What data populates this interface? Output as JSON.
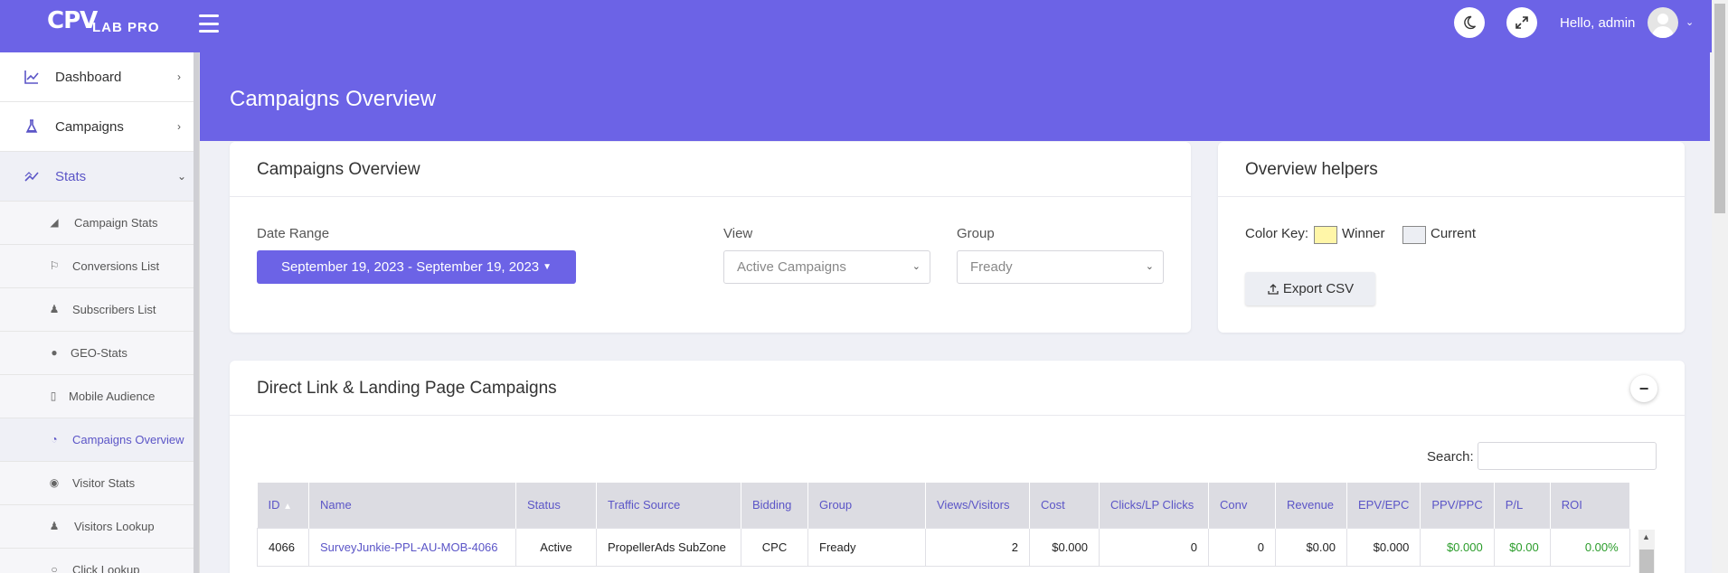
{
  "brand": {
    "mark": "CPV",
    "sub": "LAB PRO"
  },
  "topbar": {
    "greeting": "Hello, admin"
  },
  "sidebar": {
    "items": [
      {
        "label": "Dashboard"
      },
      {
        "label": "Campaigns"
      },
      {
        "label": "Stats"
      }
    ],
    "stats_sub": [
      {
        "label": "Campaign Stats"
      },
      {
        "label": "Conversions List"
      },
      {
        "label": "Subscribers List"
      },
      {
        "label": "GEO-Stats"
      },
      {
        "label": "Mobile Audience"
      },
      {
        "label": "Campaigns Overview"
      },
      {
        "label": "Visitor Stats"
      },
      {
        "label": "Visitors Lookup"
      },
      {
        "label": "Click Lookup"
      }
    ]
  },
  "page": {
    "title": "Campaigns Overview"
  },
  "overview_card": {
    "title": "Campaigns Overview",
    "date_range_label": "Date Range",
    "date_range_value": "September 19, 2023 - September 19, 2023",
    "view_label": "View",
    "view_value": "Active Campaigns",
    "group_label": "Group",
    "group_value": "Fready"
  },
  "helpers_card": {
    "title": "Overview helpers",
    "color_key_label": "Color Key:",
    "winner_label": "Winner",
    "current_label": "Current",
    "winner_color": "#fff6a8",
    "current_color": "#eceef3",
    "export_label": "Export CSV"
  },
  "campaigns_card": {
    "title": "Direct Link & Landing Page Campaigns",
    "search_label": "Search:",
    "columns": [
      "ID",
      "Name",
      "Status",
      "Traffic Source",
      "Bidding",
      "Group",
      "Views/Visitors",
      "Cost",
      "Clicks/LP Clicks",
      "Conv",
      "Revenue",
      "EPV/EPC",
      "PPV/PPC",
      "P/L",
      "ROI"
    ],
    "rows": [
      {
        "id": "4066",
        "name": "SurveyJunkie-PPL-AU-MOB-4066",
        "status": "Active",
        "traffic_source": "PropellerAds SubZone",
        "bidding": "CPC",
        "group": "Fready",
        "views": "2",
        "cost": "$0.000",
        "clicks": "0",
        "conv": "0",
        "revenue": "$0.00",
        "epv": "$0.000",
        "ppv": "$0.000",
        "pl": "$0.00",
        "roi": "0.00%"
      }
    ]
  },
  "colors": {
    "accent": "#6c63e6",
    "link": "#5b55c7",
    "positive": "#2a9c2a"
  }
}
